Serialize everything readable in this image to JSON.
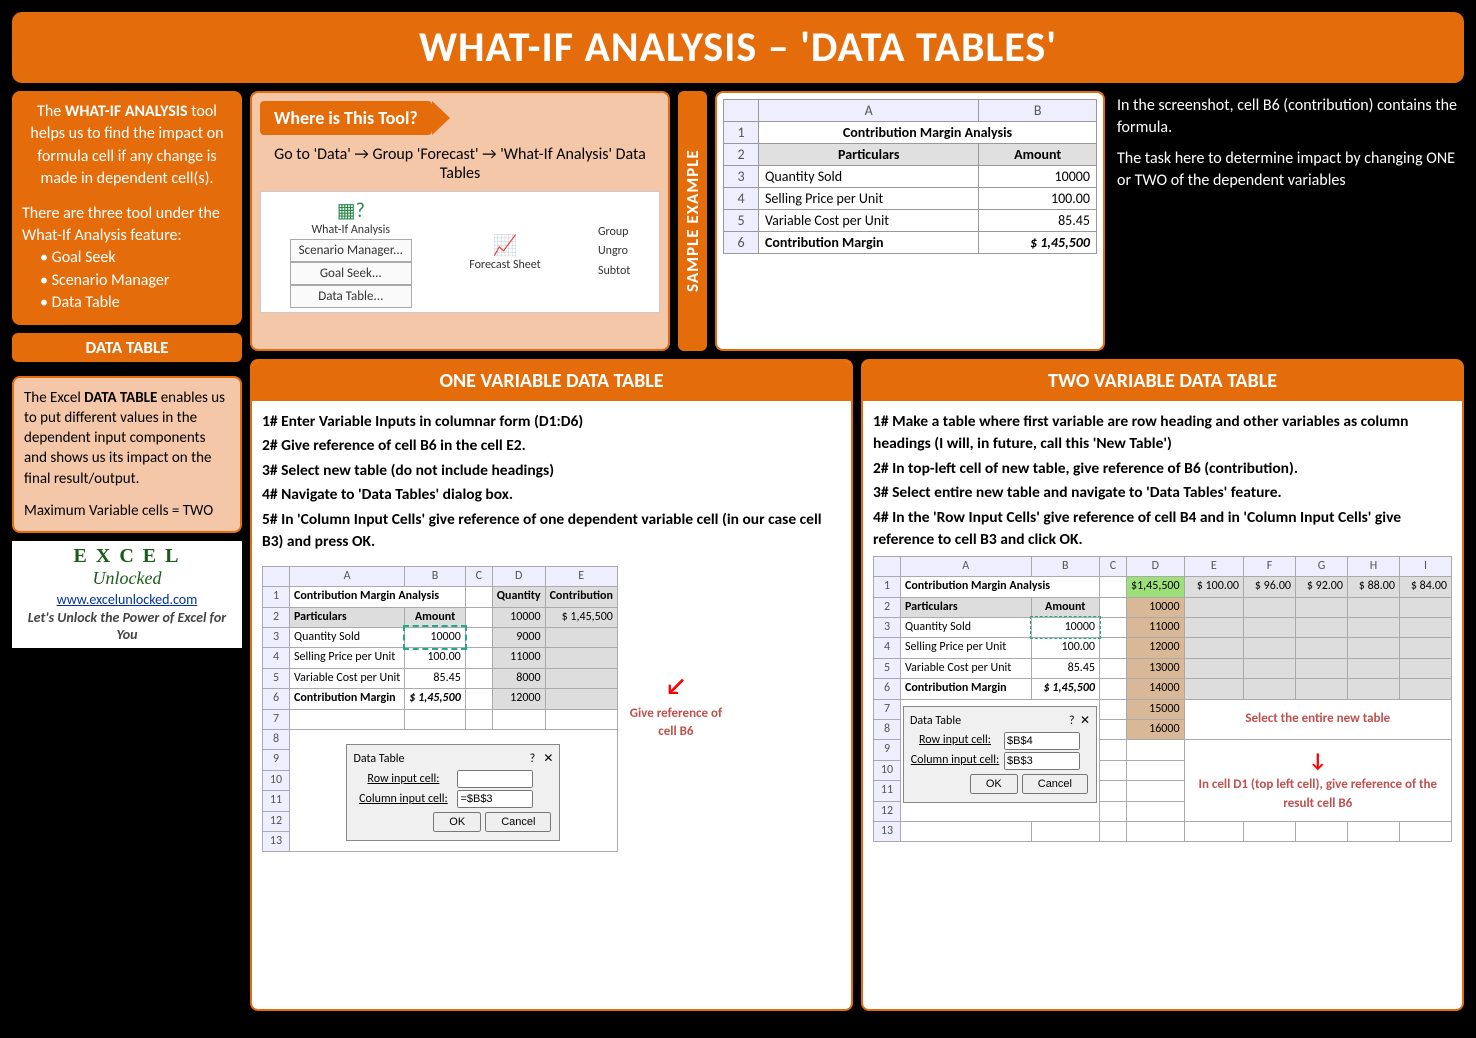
{
  "title": "WHAT-IF ANALYSIS – 'DATA TABLES'",
  "intro": {
    "p1_a": "The ",
    "p1_b": "WHAT-IF ANALYSIS",
    "p1_c": " tool helps us to find the impact on formula cell if any change is made in dependent cell(s).",
    "p2": "There are three tool under the What-If Analysis feature:",
    "li1": "Goal Seek",
    "li2": "Scenario Manager",
    "li3": "Data Table"
  },
  "dt_label": "DATA TABLE",
  "dt": {
    "p1_a": "The Excel ",
    "p1_b": "DATA TABLE",
    "p1_c": " enables us to put different values in the dependent input components and shows us its impact on the final result/output.",
    "p2": "Maximum Variable cells = TWO"
  },
  "logo": {
    "name": "E X C E L",
    "sub": "Unlocked",
    "url": "www.excelunlocked.com",
    "tag": "Let's Unlock the Power of Excel for You"
  },
  "where": {
    "title": "Where is This Tool?",
    "nav": "Go to 'Data' → Group 'Forecast' → 'What-If Analysis' Data Tables",
    "b1": "What-If Analysis",
    "b2": "Forecast Sheet",
    "g1": "Group",
    "g2": "Ungro",
    "g3": "Subtot",
    "m1": "Scenario Manager...",
    "m2": "Goal Seek...",
    "m3": "Data Table..."
  },
  "sample_tab": "SAMPLE EXAMPLE",
  "sample": {
    "h1": "Contribution Margin Analysis",
    "h2": "Particulars",
    "h3": "Amount",
    "r3a": "Quantity Sold",
    "r3b": "10000",
    "r4a": "Selling Price per Unit",
    "r4b": "100.00",
    "r5a": "Variable Cost per Unit",
    "r5b": "85.45",
    "r6a": "Contribution Margin",
    "r6b": "$  1,45,500"
  },
  "sample_desc": {
    "p1": "In the screenshot, cell B6 (contribution) contains the formula.",
    "p2": "The task here to determine impact by changing ONE or TWO of the dependent variables"
  },
  "one": {
    "title": "ONE VARIABLE DATA TABLE",
    "s1": "1# Enter Variable Inputs in columnar form (D1:D6)",
    "s2": "2# Give reference of cell B6 in the cell E2.",
    "s3": "3# Select new table (do not include headings)",
    "s4": "4# Navigate to 'Data Tables' dialog box.",
    "s5": "5# In 'Column Input Cells' give reference of one dependent variable cell (in our case cell B3) and press OK.",
    "dh": "Quantity",
    "eh": "Contribution",
    "d2": "10000",
    "e2": "$   1,45,500",
    "d3": "9000",
    "d4": "11000",
    "d5": "8000",
    "d6": "12000",
    "dlg_title": "Data Table",
    "dlg_row": "Row input cell:",
    "dlg_col": "Column input cell:",
    "dlg_col_v": "=$B$3",
    "ok": "OK",
    "cancel": "Cancel",
    "note": "Give reference of cell B6"
  },
  "two": {
    "title": "TWO VARIABLE DATA TABLE",
    "s1": "1# Make a table where first variable are row heading and other variables as column headings (I will, in future, call this 'New Table')",
    "s2": "2# In top-left cell of new table, give reference of B6 (contribution).",
    "s3": "3# Select entire new table and navigate to 'Data Tables' feature.",
    "s4": "4# In the 'Row Input Cells' give reference of cell B4 and in 'Column Input Cells' give reference to cell B3 and click OK.",
    "d1": "$1,45,500",
    "e1": "$  100.00",
    "f1": "$    96.00",
    "g1": "$    92.00",
    "h1": "$    88.00",
    "i1": "$    84.00",
    "d2": "10000",
    "d3": "11000",
    "d4": "12000",
    "d5": "13000",
    "d6": "14000",
    "d7": "15000",
    "d8": "16000",
    "dlg_row_v": "$B$4",
    "dlg_col_v": "$B$3",
    "note1": "Select the entire new table",
    "note2": "In cell D1 (top left cell), give reference of the result cell B6"
  }
}
